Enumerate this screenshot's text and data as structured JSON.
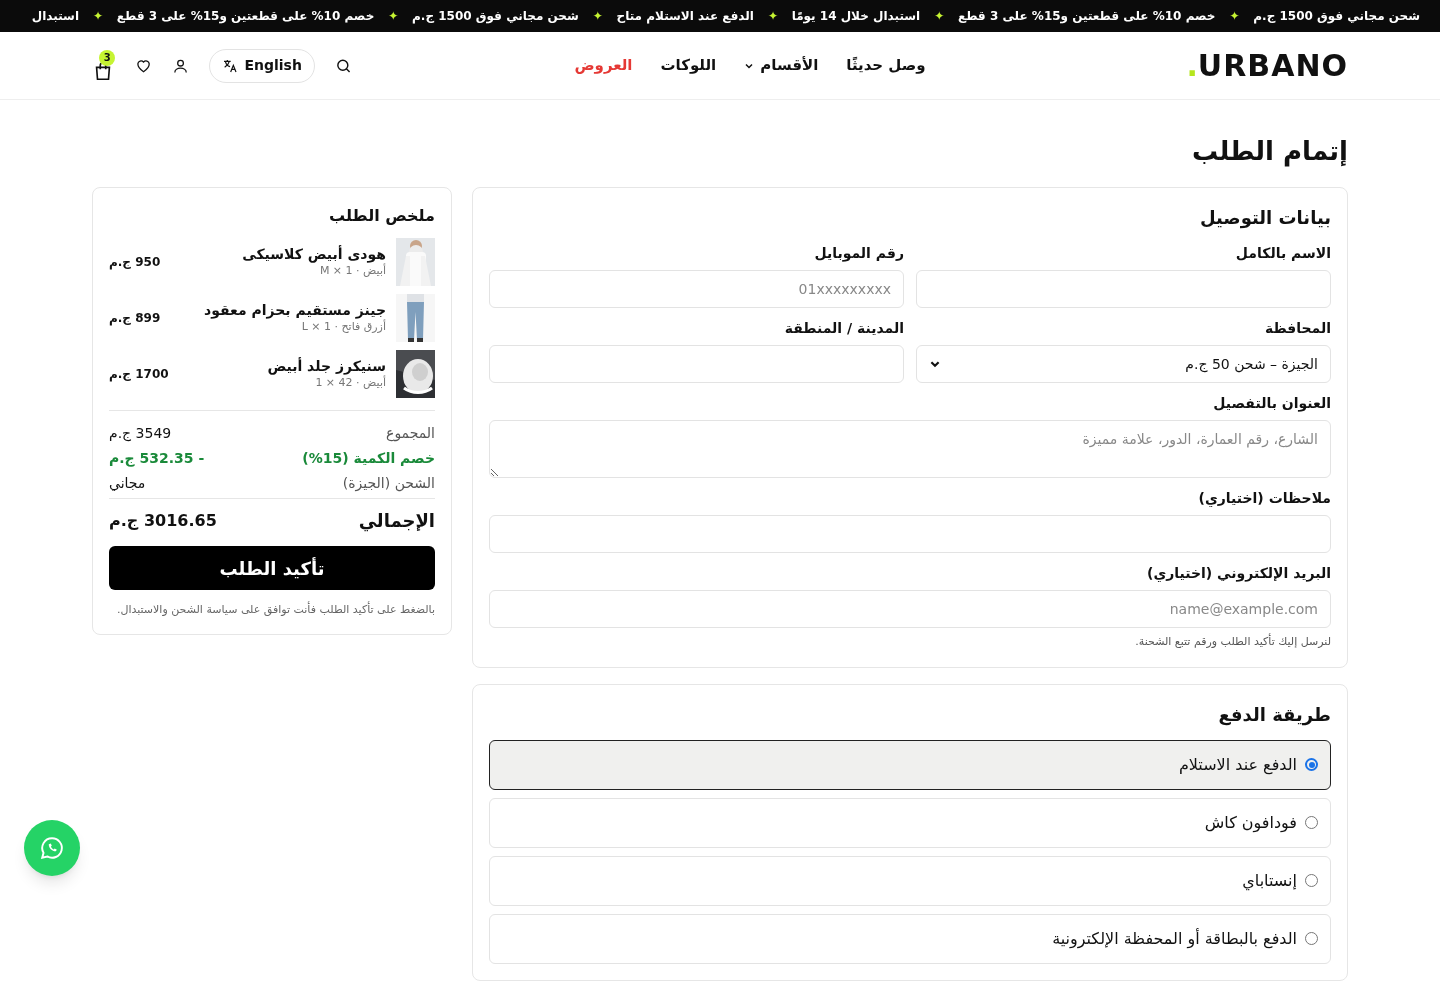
{
  "announcement_bar": {
    "items": [
      "شحن مجاني فوق 1500 ج.م",
      "خصم 10% على قطعتين و15% على 3 قطع",
      "استبدال خلال 14 يومًا",
      "الدفع عند الاستلام متاح",
      "شحن مجاني فوق 1500 ج.م",
      "خصم 10% على قطعتين و15% على 3 قطع",
      "استبدال"
    ],
    "separator": "✦"
  },
  "header": {
    "logo": "URBANO",
    "logo_dot": ".",
    "nav": [
      {
        "label": "وصل حديثًا",
        "kind": "link"
      },
      {
        "label": "الأقسام",
        "kind": "dropdown"
      },
      {
        "label": "اللوكات",
        "kind": "link"
      },
      {
        "label": "العروض",
        "kind": "sale"
      }
    ],
    "language_button": "English",
    "cart_count": "3"
  },
  "page_title": "إتمام الطلب",
  "delivery": {
    "title": "بيانات التوصيل",
    "rows": [
      [
        {
          "label": "الاسم بالكامل",
          "kind": "input"
        },
        {
          "label": "رقم الموبايل",
          "kind": "input",
          "placeholder": "01xxxxxxxxx"
        }
      ],
      [
        {
          "label": "المحافظة",
          "kind": "select",
          "value": "الجيزة – شحن 50 ج.م"
        },
        {
          "label": "المدينة / المنطقة",
          "kind": "input"
        }
      ],
      [
        {
          "label": "العنوان بالتفصيل",
          "kind": "textarea",
          "placeholder": "الشارع، رقم العمارة، الدور، علامة مميزة"
        }
      ],
      [
        {
          "label": "ملاحظات (اختياري)",
          "kind": "input"
        }
      ],
      [
        {
          "label": "البريد الإلكتروني (اختياري)",
          "kind": "input",
          "placeholder": "name@example.com",
          "hint": "لنرسل إليك تأكيد الطلب ورقم تتبع الشحنة."
        }
      ]
    ]
  },
  "payment": {
    "title": "طريقة الدفع",
    "options": [
      {
        "label": "الدفع عند الاستلام",
        "selected": true
      },
      {
        "label": "فودافون كاش",
        "selected": false
      },
      {
        "label": "إنستاباي",
        "selected": false
      },
      {
        "label": "الدفع بالبطاقة أو المحفظة الإلكترونية",
        "selected": false
      }
    ]
  },
  "summary": {
    "title": "ملخص الطلب",
    "items": [
      {
        "name": "هودى أبيض كلاسيكى",
        "details": "أبيض · 1 × M",
        "price": "950 ج.م"
      },
      {
        "name": "جينز مستقيم بحزام معقود",
        "details": "أزرق فاتح · 1 × L",
        "price": "899 ج.م"
      },
      {
        "name": "سنيكرز جلد أبيض",
        "details": "أبيض · 42 × 1",
        "price": "1700 ج.م"
      }
    ],
    "lines": [
      {
        "label": "المجموع",
        "value": "3549 ج.م",
        "kind": "normal"
      },
      {
        "label": "خصم الكمية (15%)",
        "value": "- 532.35 ج.م",
        "kind": "discount"
      },
      {
        "label": "الشحن (الجيزة)",
        "value": "مجاني",
        "kind": "normal"
      }
    ],
    "total": {
      "label": "الإجمالي",
      "value": "3016.65 ج.م"
    },
    "button": "تأكيد الطلب",
    "note": "بالضغط على تأكيد الطلب فأنت توافق على سياسة الشحن والاستبدال."
  }
}
